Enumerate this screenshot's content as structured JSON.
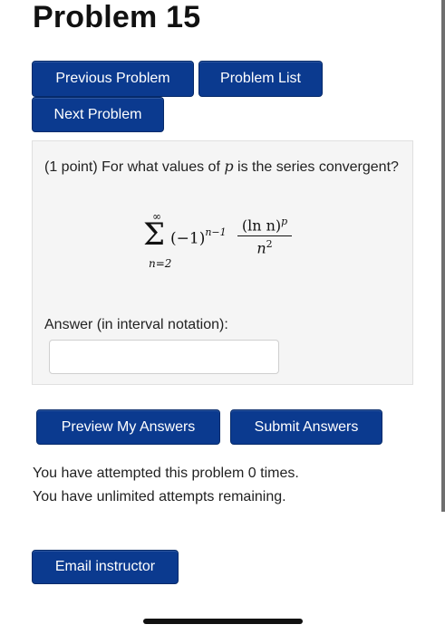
{
  "page": {
    "title": "Problem 15"
  },
  "nav": {
    "previous_label": "Previous Problem",
    "list_label": "Problem List",
    "next_label": "Next Problem"
  },
  "problem": {
    "points": "(1 point)",
    "question_before": "For what values of",
    "variable": "p",
    "question_after": "is the series convergent?",
    "formula": {
      "sum_upper": "∞",
      "sum_lower": "n=2",
      "factor_base": "(−1)",
      "factor_exponent": "n−1",
      "numerator": "(ln n)",
      "numerator_exponent": "p",
      "denominator": "n",
      "denominator_exponent": "2"
    },
    "answer_label": "Answer (in interval notation):",
    "answer_value": ""
  },
  "actions": {
    "preview_label": "Preview My Answers",
    "submit_label": "Submit Answers"
  },
  "status": {
    "attempts_line": "You have attempted this problem 0 times.",
    "remaining_line": "You have unlimited attempts remaining."
  },
  "contact": {
    "email_label": "Email instructor"
  },
  "colors": {
    "button_bg": "#0b3a8f",
    "panel_bg": "#f5f5f5"
  }
}
